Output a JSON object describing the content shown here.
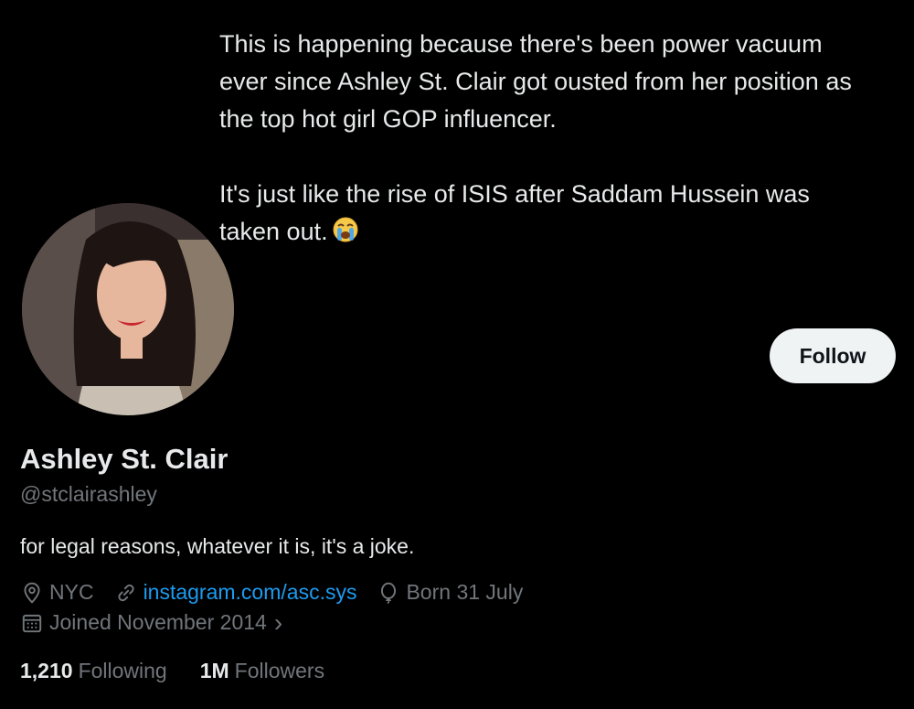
{
  "tweet": {
    "paragraph1": "This is happening because there's been power vacuum ever since Ashley St. Clair got ousted from her position as the top hot girl GOP influencer.",
    "paragraph2": "It's just like the rise of ISIS after Saddam Hussein was taken out.",
    "emoji_icon": "loudly-crying-face-icon"
  },
  "profile": {
    "follow_label": "Follow",
    "display_name": "Ashley St. Clair",
    "handle": "@stclairashley",
    "bio": "for legal reasons, whatever it is, it's a joke.",
    "location": "NYC",
    "website": "instagram.com/asc.sys",
    "birthday": "Born 31 July",
    "joined": "Joined November 2014",
    "joined_chevron": "›",
    "following_count": "1,210",
    "following_label": "Following",
    "followers_count": "1M",
    "followers_label": "Followers"
  },
  "colors": {
    "background": "#000000",
    "text": "#e7e9ea",
    "secondary_text": "#71767b",
    "link": "#1d9bf0",
    "button_bg": "#eff3f4"
  }
}
